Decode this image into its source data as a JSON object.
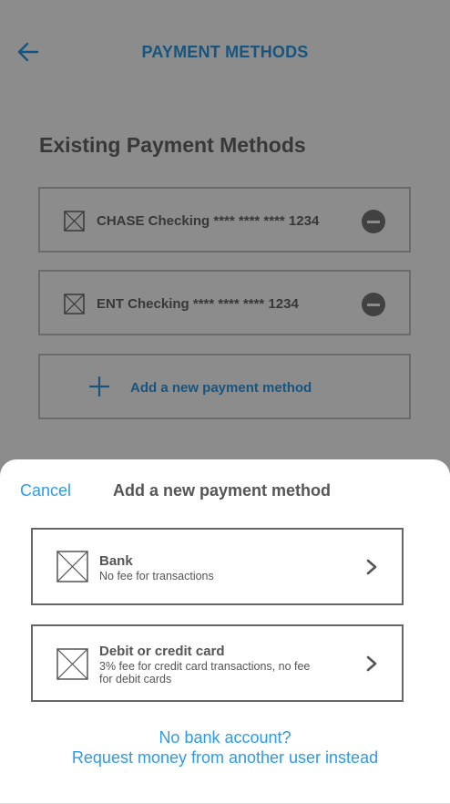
{
  "header": {
    "title": "PAYMENT METHODS"
  },
  "existing": {
    "title": "Existing Payment Methods",
    "methods": [
      {
        "name": "CHASE Checking",
        "masked": "**** **** **** 1234"
      },
      {
        "name": "ENT Checking",
        "masked": "**** **** **** 1234"
      }
    ],
    "add_label": "Add a new payment method"
  },
  "sheet": {
    "cancel_label": "Cancel",
    "title": "Add a new payment method",
    "options": [
      {
        "title": "Bank",
        "description": "No fee for transactions"
      },
      {
        "title": "Debit or credit card",
        "description": "3% fee for credit card transactions, no fee for debit cards"
      }
    ],
    "no_bank_text": "No bank account?",
    "request_text": "Request money from another user instead"
  },
  "colors": {
    "accent": "#2d9be6",
    "overlay": "rgba(0,0,0,0.45)"
  },
  "icons": {
    "back": "arrow-left-icon",
    "remove": "minus-circle-icon",
    "add": "plus-icon",
    "thumbnail": "image-placeholder-icon",
    "chevron": "chevron-right-icon"
  }
}
